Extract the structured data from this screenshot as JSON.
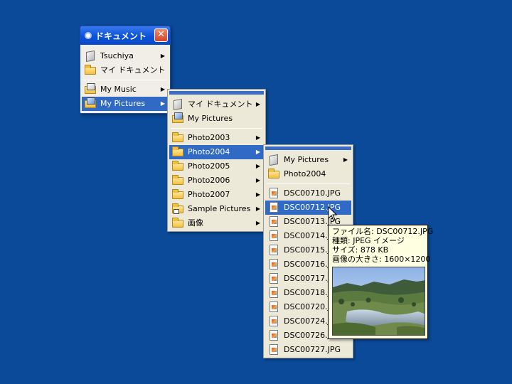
{
  "colors": {
    "desktop": "#0a4a98",
    "selection": "#316ac5",
    "menu": "#ece9d8",
    "tooltip": "#ffffe1"
  },
  "window": {
    "title": "ドキュメント",
    "close_glyph": "✕",
    "items": [
      {
        "label": "Tsuchiya",
        "icon": "document-icon",
        "submenu": true
      },
      {
        "label": "マイ ドキュメント",
        "icon": "folder-icon",
        "submenu": false
      },
      {
        "label": "My Music",
        "icon": "music-folder-icon",
        "submenu": true
      },
      {
        "label": "My Pictures",
        "icon": "pictures-folder-icon",
        "submenu": true,
        "selected": true
      }
    ]
  },
  "menu1": {
    "items": [
      {
        "label": "マイ ドキュメント",
        "icon": "document-icon",
        "submenu": true
      },
      {
        "label": "My Pictures",
        "icon": "pictures-folder-icon",
        "submenu": false
      },
      {
        "label": "Photo2003",
        "icon": "folder-icon",
        "submenu": true
      },
      {
        "label": "Photo2004",
        "icon": "folder-icon",
        "submenu": true,
        "selected": true
      },
      {
        "label": "Photo2005",
        "icon": "folder-icon",
        "submenu": true
      },
      {
        "label": "Photo2006",
        "icon": "folder-icon",
        "submenu": true
      },
      {
        "label": "Photo2007",
        "icon": "folder-icon",
        "submenu": true
      },
      {
        "label": "Sample Pictures",
        "icon": "shortcut-folder-icon",
        "submenu": true
      },
      {
        "label": "画像",
        "icon": "folder-icon",
        "submenu": true
      }
    ]
  },
  "menu2": {
    "items": [
      {
        "label": "My Pictures",
        "icon": "document-icon",
        "submenu": true
      },
      {
        "label": "Photo2004",
        "icon": "folder-icon",
        "submenu": false
      },
      {
        "label": "DSC00710.JPG",
        "icon": "jpg-file-icon"
      },
      {
        "label": "DSC00712.JPG",
        "icon": "jpg-file-icon",
        "selected": true
      },
      {
        "label": "DSC00713.JPG",
        "icon": "jpg-file-icon"
      },
      {
        "label": "DSC00714.JPG",
        "icon": "jpg-file-icon"
      },
      {
        "label": "DSC00715.JPG",
        "icon": "jpg-file-icon"
      },
      {
        "label": "DSC00716.JPG",
        "icon": "jpg-file-icon"
      },
      {
        "label": "DSC00717.JPG",
        "icon": "jpg-file-icon"
      },
      {
        "label": "DSC00718.JPG",
        "icon": "jpg-file-icon"
      },
      {
        "label": "DSC00720.JPG",
        "icon": "jpg-file-icon"
      },
      {
        "label": "DSC00724.JPG",
        "icon": "jpg-file-icon"
      },
      {
        "label": "DSC00726.JPG",
        "icon": "jpg-file-icon"
      },
      {
        "label": "DSC00727.JPG",
        "icon": "jpg-file-icon"
      }
    ]
  },
  "tooltip": {
    "line1": "ファイル名: DSC00712.JPG",
    "line2": "種類: JPEG イメージ",
    "line3": "サイズ: 878 KB",
    "line4": "画像の大きさ: 1600×1200"
  }
}
